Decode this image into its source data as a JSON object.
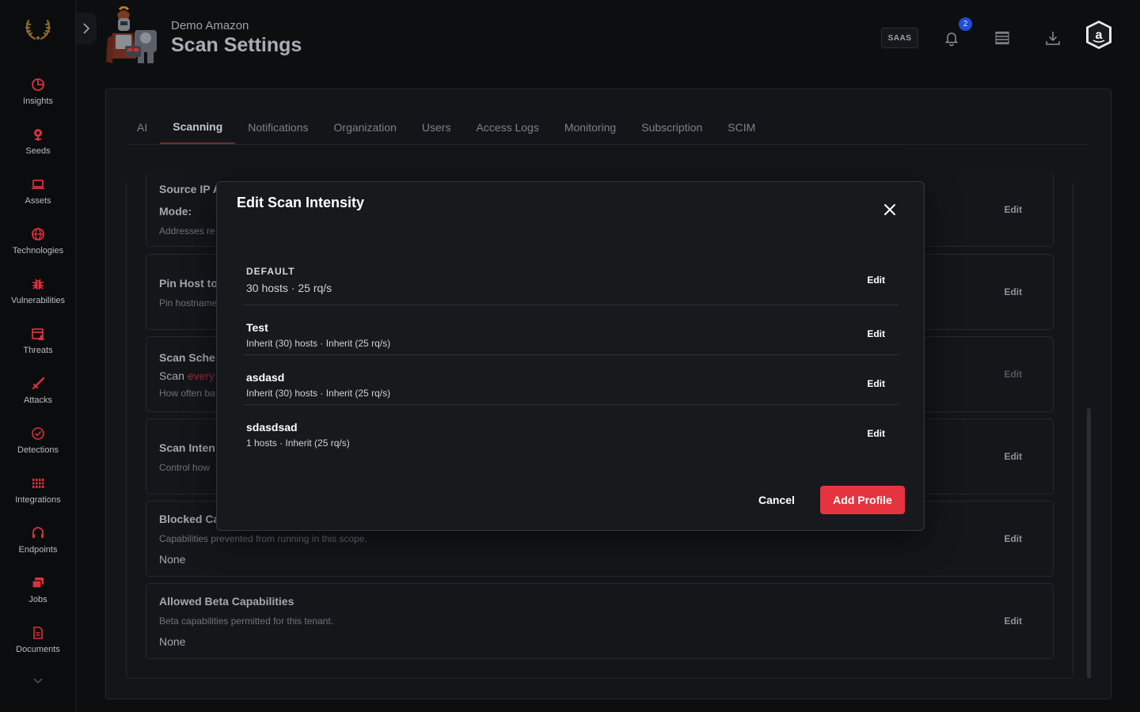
{
  "header": {
    "org_name": "Demo Amazon",
    "page_title": "Scan Settings",
    "badge": "SAAS",
    "notification_count": "2"
  },
  "sidebar": {
    "items": [
      {
        "label": "Insights",
        "icon": "pie-chart-icon"
      },
      {
        "label": "Seeds",
        "icon": "seed-flower-icon"
      },
      {
        "label": "Assets",
        "icon": "laptop-icon"
      },
      {
        "label": "Technologies",
        "icon": "globe-icon"
      },
      {
        "label": "Vulnerabilities",
        "icon": "bug-icon"
      },
      {
        "label": "Threats",
        "icon": "calendar-alert-icon"
      },
      {
        "label": "Attacks",
        "icon": "sword-icon"
      },
      {
        "label": "Detections",
        "icon": "check-circle-icon"
      },
      {
        "label": "Integrations",
        "icon": "grid-icon"
      },
      {
        "label": "Endpoints",
        "icon": "headset-icon"
      },
      {
        "label": "Jobs",
        "icon": "stack-icon"
      },
      {
        "label": "Documents",
        "icon": "document-icon"
      }
    ]
  },
  "tabs": [
    {
      "label": "AI",
      "active": false
    },
    {
      "label": "Scanning",
      "active": true
    },
    {
      "label": "Notifications",
      "active": false
    },
    {
      "label": "Organization",
      "active": false
    },
    {
      "label": "Users",
      "active": false
    },
    {
      "label": "Access Logs",
      "active": false
    },
    {
      "label": "Monitoring",
      "active": false
    },
    {
      "label": "Subscription",
      "active": false
    },
    {
      "label": "SCIM",
      "active": false
    }
  ],
  "settings": {
    "source_ip": {
      "title": "Source IP A",
      "mode_label": "Mode:",
      "subtitle": "Addresses re",
      "edit": "Edit"
    },
    "pin_host": {
      "title": "Pin Host to",
      "subtitle": "Pin hostname",
      "edit": "Edit"
    },
    "scan_schedule": {
      "title": "Scan Sche",
      "value_prefix": "Scan ",
      "value_highlight": "every",
      "subtitle": "How often ba",
      "edit": "Edit"
    },
    "scan_intensity": {
      "title": "Scan Inten",
      "subtitle": "Control how",
      "edit": "Edit"
    },
    "blocked": {
      "title": "Blocked Ca",
      "subtitle": "Capabilities prevented from running in this scope.",
      "value": "None",
      "edit": "Edit"
    },
    "beta": {
      "title": "Allowed Beta Capabilities",
      "subtitle": "Beta capabilities permitted for this tenant.",
      "value": "None",
      "edit": "Edit"
    }
  },
  "modal": {
    "title": "Edit Scan Intensity",
    "default_profile": {
      "label": "DEFAULT",
      "detail": "30 hosts · 25 rq/s",
      "edit": "Edit"
    },
    "profiles": [
      {
        "name": "Test",
        "detail": "Inherit (30) hosts · Inherit (25 rq/s)",
        "edit": "Edit"
      },
      {
        "name": "asdasd",
        "detail": "Inherit (30) hosts · Inherit (25 rq/s)",
        "edit": "Edit"
      },
      {
        "name": "sdasdsad",
        "detail": "1 hosts · Inherit (25 rq/s)",
        "edit": "Edit"
      }
    ],
    "cancel_label": "Cancel",
    "add_label": "Add Profile"
  },
  "colors": {
    "accent": "#e5343f",
    "sidebar_icon": "#d8323d",
    "background": "#0d0e10"
  }
}
